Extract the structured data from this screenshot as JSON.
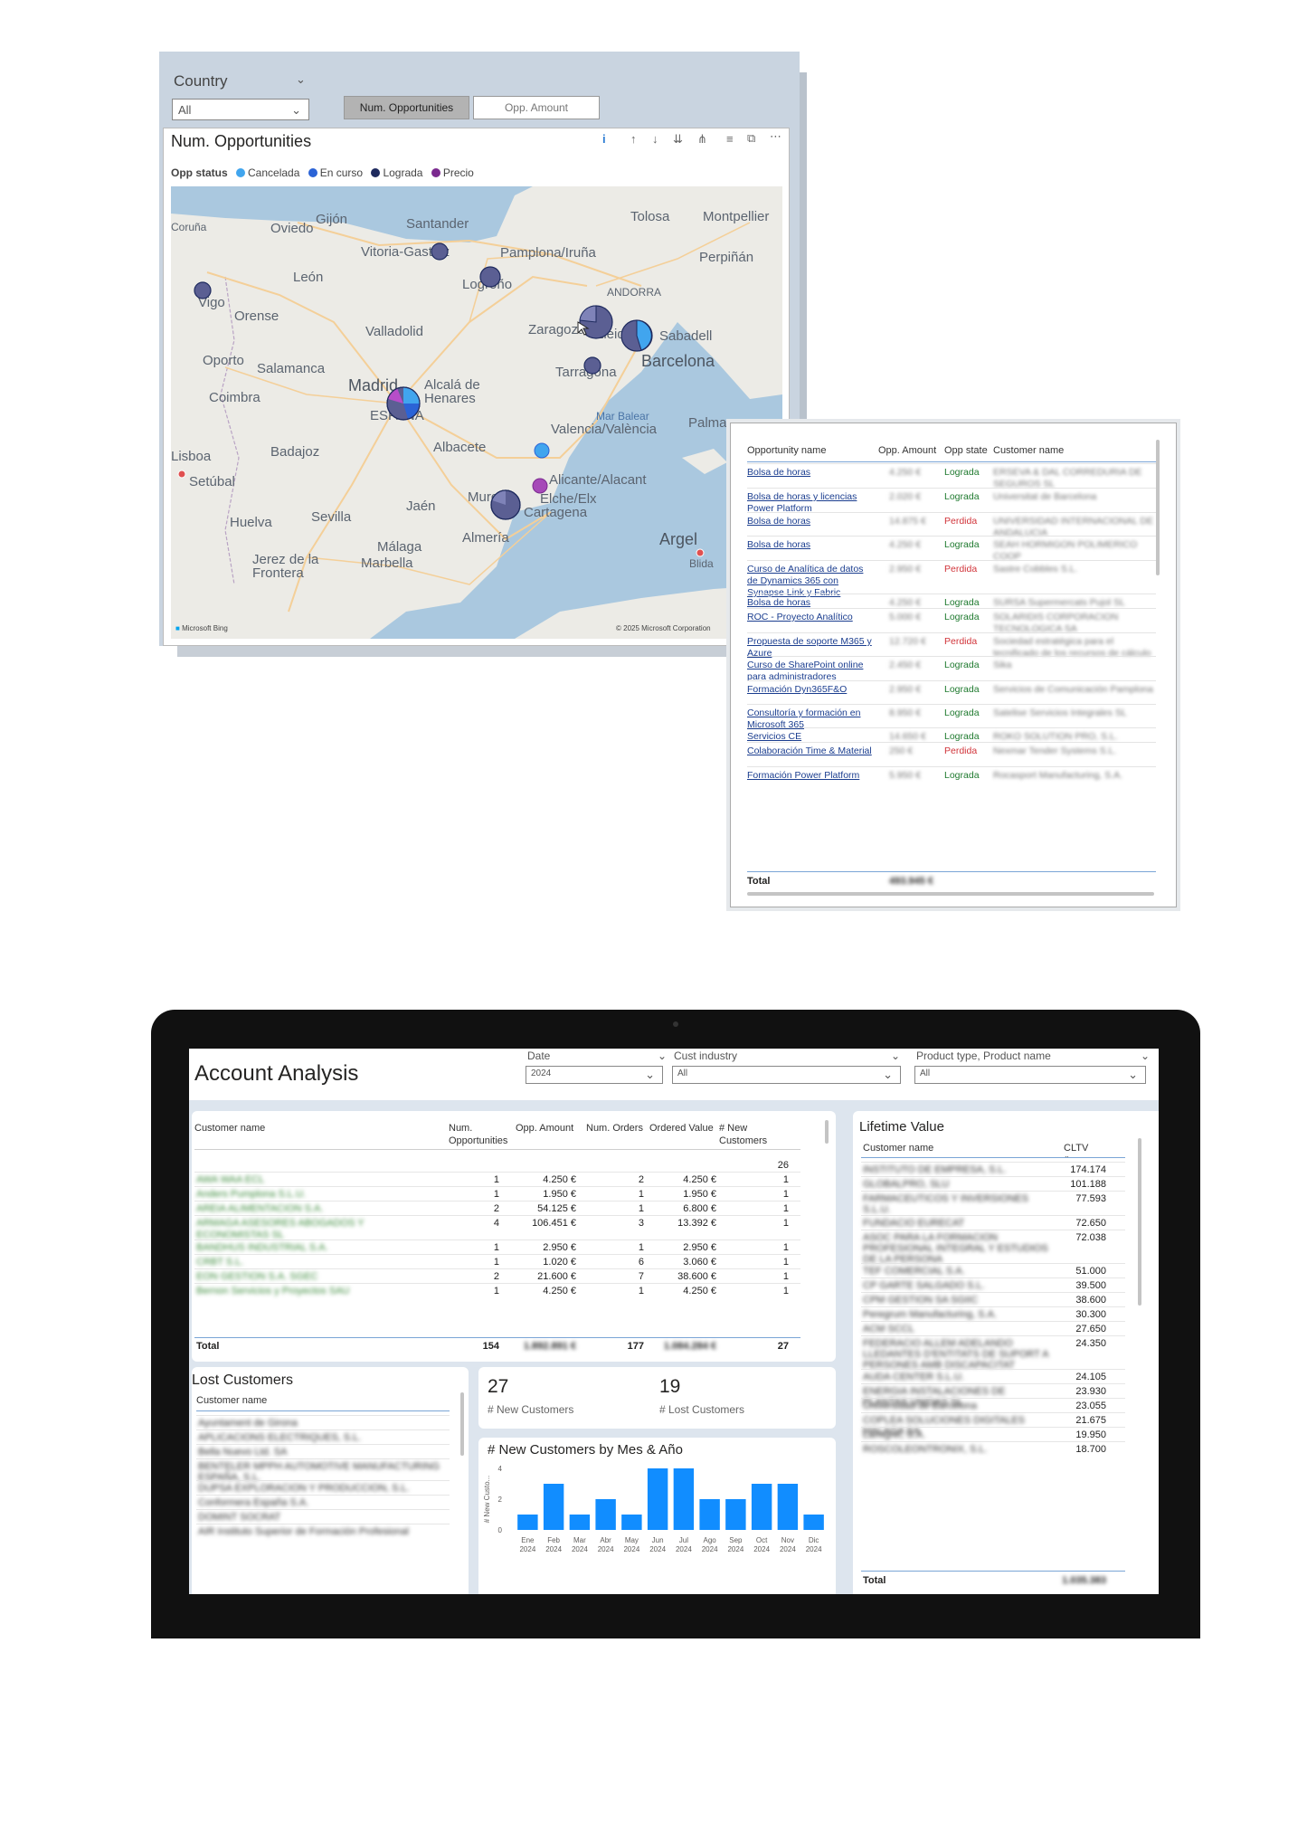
{
  "map_report": {
    "slicer_label": "Country",
    "slicer_value": "All",
    "toggle_buttons": [
      "Num. Opportunities",
      "Opp. Amount"
    ],
    "visual_title": "Num. Opportunities",
    "legend_title": "Opp status",
    "legend": [
      {
        "name": "Cancelada",
        "color": "#41a5ee"
      },
      {
        "name": "En curso",
        "color": "#2b63d6"
      },
      {
        "name": "Lograda",
        "color": "#1e2a5e"
      },
      {
        "name": "Precio",
        "color": "#7b2a8f"
      }
    ],
    "cities": [
      "Coruña",
      "Gijón",
      "Oviedo",
      "Santander",
      "Tolosa",
      "Montpellier",
      "Vitoria-Gasteiz",
      "Pamplona/Iruña",
      "Perpiñán",
      "León",
      "Logroño",
      "ANDORRA",
      "Vigo",
      "Orense",
      "Valladolid",
      "Zaragoza",
      "Lleida",
      "Sabadell",
      "Oporto",
      "Salamanca",
      "Tarragona",
      "Barcelona",
      "Coimbra",
      "Madrid",
      "Alcalá de Henares",
      "ESPAÑA",
      "Mar Balear",
      "Palma",
      "Valencia/València",
      "Lisboa",
      "Badajoz",
      "Albacete",
      "Setúbal",
      "Alicante/Alacant",
      "Murcia",
      "Elche/Elx",
      "Jaén",
      "Cartagena",
      "Huelva",
      "Sevilla",
      "Málaga",
      "Almería",
      "Argel",
      "Blida",
      "Marbella",
      "Jerez de la Frontera"
    ],
    "attribution_left": "Microsoft Bing",
    "attribution_right": "© 2025 Microsoft Corporation",
    "map_colors": {
      "land": "#ecebe6",
      "sea": "#aac8df",
      "road": "#f7d5a0"
    }
  },
  "opportunity_table": {
    "headers": [
      "Opportunity name",
      "Opp. Amount",
      "Opp state",
      "Customer name"
    ],
    "rows": [
      {
        "name": "Bolsa de horas",
        "amount": "4.250 €",
        "state": "Lograda",
        "customer": "ERSEVA & DAL CORREDURIA DE SEGUROS SL"
      },
      {
        "name": "Bolsa de horas y licencias Power Platform",
        "amount": "2.020 €",
        "state": "Lograda",
        "customer": "Universitat de Barcelona"
      },
      {
        "name": "Bolsa de horas",
        "amount": "14.875 €",
        "state": "Perdida",
        "customer": "UNIVERSIDAD INTERNACIONAL DE ANDALUCIA"
      },
      {
        "name": "Bolsa de horas",
        "amount": "4.250 €",
        "state": "Lograda",
        "customer": "SEAH HORMIGON POLIMERICO COOP"
      },
      {
        "name": "Curso de Analítica de datos de Dynamics 365 con Synapse Link y Fabric",
        "amount": "2.950 €",
        "state": "Perdida",
        "customer": "Sastre Cobbles S.L."
      },
      {
        "name": "Bolsa de horas",
        "amount": "4.250 €",
        "state": "Lograda",
        "customer": "SURSA Supermercats Pujol SL"
      },
      {
        "name": "ROC - Proyecto Analítico",
        "amount": "5.000 €",
        "state": "Lograda",
        "customer": "SOLARIDIS CORPORACION TECNOLOGICA SA"
      },
      {
        "name": "Propuesta de soporte M365 y Azure",
        "amount": "12.720 €",
        "state": "Perdida",
        "customer": "Sociedad estratégica para el tecnificado de los recursos de cálculo"
      },
      {
        "name": "Curso de SharePoint online para administradores",
        "amount": "2.450 €",
        "state": "Lograda",
        "customer": "Sika"
      },
      {
        "name": "Formación Dyn365F&O",
        "amount": "2.950 €",
        "state": "Lograda",
        "customer": "Servicios de Comunicación Pamplona"
      },
      {
        "name": "Consultoría y formación en Microsoft 365",
        "amount": "8.950 €",
        "state": "Lograda",
        "customer": "Satelise Servicios Integrales SL"
      },
      {
        "name": "Servicios CE",
        "amount": "14.650 €",
        "state": "Lograda",
        "customer": "ROKO SOLUTION PRO, S.L."
      },
      {
        "name": "Colaboración Time & Material",
        "amount": "250 €",
        "state": "Perdida",
        "customer": "Nexmar Tender Systems S.L."
      },
      {
        "name": "Formación Power Platform",
        "amount": "5.950 €",
        "state": "Lograda",
        "customer": "Rocasport Manufacturing, S.A."
      }
    ],
    "total_label": "Total",
    "total_value": "493.945 €"
  },
  "account_analysis": {
    "title": "Account Analysis",
    "slicers": [
      {
        "label": "Date",
        "value": "2024"
      },
      {
        "label": "Cust industry",
        "value": "All"
      },
      {
        "label": "Product type, Product name",
        "value": "All"
      }
    ],
    "customers_table": {
      "headers": [
        "Customer name",
        "Num. Opportunities",
        "Opp. Amount",
        "Num. Orders",
        "Ordered Value",
        "# New Customers"
      ],
      "first_row_new": "26",
      "rows": [
        {
          "name": "AWA WAA ECL",
          "opps": "1",
          "amount": "4.250 €",
          "orders": "2",
          "value": "4.250 €",
          "newc": "1"
        },
        {
          "name": "Anders Pumplona S.L.U.",
          "opps": "1",
          "amount": "1.950 €",
          "orders": "1",
          "value": "1.950 €",
          "newc": "1"
        },
        {
          "name": "AREIA ALIMENTACION S.A.",
          "opps": "2",
          "amount": "54.125 €",
          "orders": "1",
          "value": "6.800 €",
          "newc": "1"
        },
        {
          "name": "ARMAGA ASESORES ABOGADOS Y ECONOMISTAS SL",
          "opps": "4",
          "amount": "106.451 €",
          "orders": "3",
          "value": "13.392 €",
          "newc": "1"
        },
        {
          "name": "BANDHUS INDUSTRIAL S.A.",
          "opps": "1",
          "amount": "2.950 €",
          "orders": "1",
          "value": "2.950 €",
          "newc": "1"
        },
        {
          "name": "CRBT S.L.",
          "opps": "1",
          "amount": "1.020 €",
          "orders": "6",
          "value": "3.060 €",
          "newc": "1"
        },
        {
          "name": "EON GESTION S.A. SGEC",
          "opps": "2",
          "amount": "21.600 €",
          "orders": "7",
          "value": "38.600 €",
          "newc": "1"
        },
        {
          "name": "Bernon Servicios y Proyectos SAU",
          "opps": "1",
          "amount": "4.250 €",
          "orders": "1",
          "value": "4.250 €",
          "newc": "1"
        }
      ],
      "total": {
        "label": "Total",
        "opps": "154",
        "amount": "1.892.891 €",
        "orders": "177",
        "value": "1.084.284 €",
        "newc": "27"
      }
    },
    "lost_customers": {
      "title": "Lost Customers",
      "header": "Customer name",
      "rows": [
        "Ayuntament de Girona",
        "APLICACIONS ELECTRIQUES, S.L.",
        "Bella Nuevo Ltd. SA",
        "BENTELER MPPH AUTOMOTIVE MANUFACTURING ESPAÑA, S.L.",
        "DUPSA EXPLORACION Y PRODUCCION, S.L.",
        "Conformera España S.A.",
        "DOMINT SOCRAT",
        "AIR Instituto Superior de Formación Profesional"
      ]
    },
    "cards": [
      {
        "value": "27",
        "label": "# New Customers"
      },
      {
        "value": "19",
        "label": "# Lost Customers"
      }
    ],
    "lifetime": {
      "title": "Lifetime Value",
      "headers": [
        "Customer name",
        "CLTV"
      ],
      "rows": [
        {
          "name": "INSTITUTO DE EMPRESA, S.L.",
          "v": "174.174"
        },
        {
          "name": "GLOBALPRO, SLU",
          "v": "101.188"
        },
        {
          "name": "FARMACEUTICOS Y INVERSIONES S.L.U.",
          "v": "77.593"
        },
        {
          "name": "FUNDACIO EURECAT",
          "v": "72.650"
        },
        {
          "name": "ASOC PARA LA FORMACION PROFESIONAL INTEGRAL Y ESTUDIOS DE LA PERSONA",
          "v": "72.038"
        },
        {
          "name": "TEF COMERCIAL S.A.",
          "v": "51.000"
        },
        {
          "name": "CP GARTE SALGADO S.L.",
          "v": "39.500"
        },
        {
          "name": "CPM GESTION SA SGIIC",
          "v": "38.600"
        },
        {
          "name": "Peregrum Manufacturing, S.A.",
          "v": "30.300"
        },
        {
          "name": "ACM SCCL",
          "v": "27.650"
        },
        {
          "name": "FEDERACIO ALLEM ADELANDO LLEDANTES D'ENTITATS DE SUPORT A PERSONES AMB DISCAPACITAT",
          "v": "24.350"
        },
        {
          "name": "AUDA CENTER S.L.U.",
          "v": "24.105"
        },
        {
          "name": "ENERGIA INSTALACIONES DE PLANTAS UNIDAS SL",
          "v": "23.930"
        },
        {
          "name": "Universidad de Barcelona",
          "v": "23.055"
        },
        {
          "name": "COPLEA SOLUCIONES DIGITALES MALAGA SA",
          "v": "21.675"
        },
        {
          "name": "Lamigrel, S.A.",
          "v": "19.950"
        },
        {
          "name": "ROSCOLEONTRONIX, S.L.",
          "v": "18.700"
        }
      ],
      "total_label": "Total",
      "total_value": "1.035.383"
    }
  },
  "chart_data": {
    "type": "bar",
    "title": "# New Customers by Mes & Año",
    "ylabel": "# New Custo...",
    "categories": [
      "Ene 2024",
      "Feb 2024",
      "Mar 2024",
      "Abr 2024",
      "May 2024",
      "Jun 2024",
      "Jul 2024",
      "Ago 2024",
      "Sep 2024",
      "Oct 2024",
      "Nov 2024",
      "Dic 2024"
    ],
    "values": [
      1,
      3,
      1,
      2,
      1,
      4,
      4,
      2,
      2,
      3,
      3,
      1
    ],
    "ylim": [
      0,
      4
    ],
    "yticks": [
      0,
      2,
      4
    ],
    "bar_color": "#118dff",
    "grid": false
  }
}
